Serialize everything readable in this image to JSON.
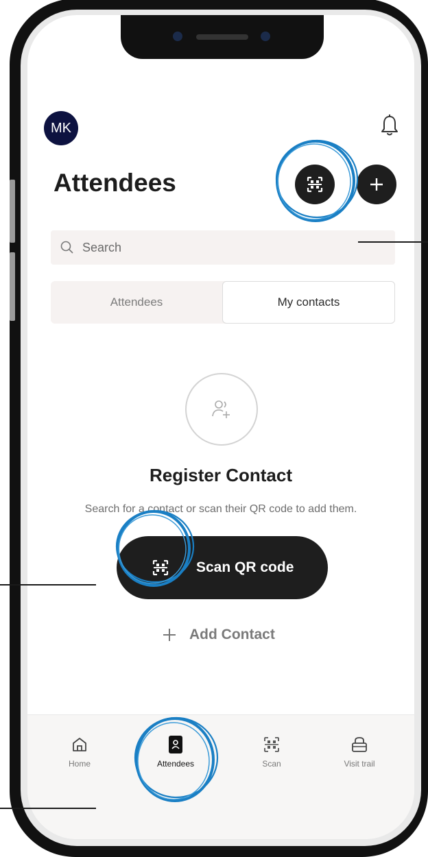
{
  "header": {
    "avatar_initials": "MK",
    "title": "Attendees"
  },
  "search": {
    "placeholder": "Search"
  },
  "tabs": [
    {
      "label": "Attendees",
      "active": false
    },
    {
      "label": "My contacts",
      "active": true
    }
  ],
  "empty_state": {
    "title": "Register Contact",
    "description": "Search for a contact or scan their QR code to add them.",
    "scan_label": "Scan QR code",
    "add_label": "Add Contact"
  },
  "bottom_nav": [
    {
      "label": "Home",
      "icon": "home-icon"
    },
    {
      "label": "Attendees",
      "icon": "contact-book-icon",
      "active": true
    },
    {
      "label": "Scan",
      "icon": "qr-scan-icon"
    },
    {
      "label": "Visit trail",
      "icon": "bag-icon"
    }
  ],
  "colors": {
    "primary": "#1e1e1e",
    "avatar_bg": "#0d1240",
    "highlight_ring": "#1a7fc4",
    "surface": "#f6f2f1"
  }
}
